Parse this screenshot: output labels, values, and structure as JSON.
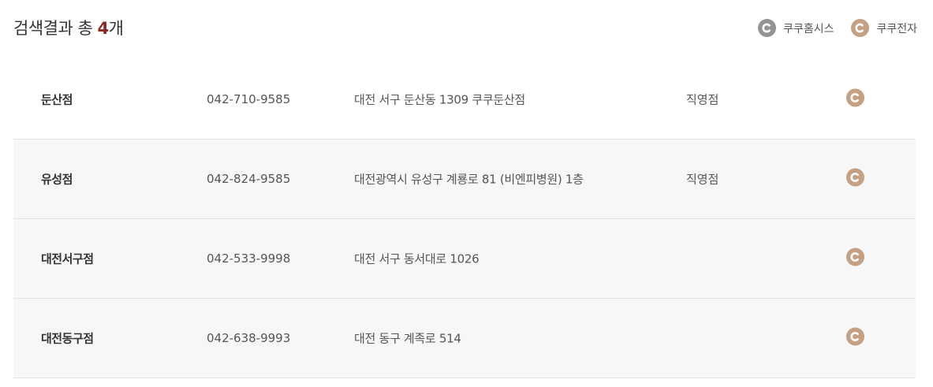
{
  "header": {
    "title_prefix": "검색결과 총 ",
    "count": "4",
    "title_suffix": "개"
  },
  "legend": [
    {
      "label": "쿠쿠홈시스",
      "icon": "cuckoo-c-icon",
      "color": "#949494"
    },
    {
      "label": "쿠쿠전자",
      "icon": "cuckoo-c-icon",
      "color": "#c5a082"
    }
  ],
  "stores": [
    {
      "name": "둔산점",
      "phone": "042-710-9585",
      "address": "대전 서구 둔산동 1309 쿠쿠둔산점",
      "type": "직영점",
      "brand_icon": "cuckoo-c-icon"
    },
    {
      "name": "유성점",
      "phone": "042-824-9585",
      "address": "대전광역시 유성구 계룡로 81 (비엔피병원) 1층",
      "type": "직영점",
      "brand_icon": "cuckoo-c-icon"
    },
    {
      "name": "대전서구점",
      "phone": "042-533-9998",
      "address": "대전 서구 동서대로 1026",
      "type": "",
      "brand_icon": "cuckoo-c-icon"
    },
    {
      "name": "대전동구점",
      "phone": "042-638-9993",
      "address": "대전 동구 계족로 514",
      "type": "",
      "brand_icon": "cuckoo-c-icon"
    }
  ]
}
